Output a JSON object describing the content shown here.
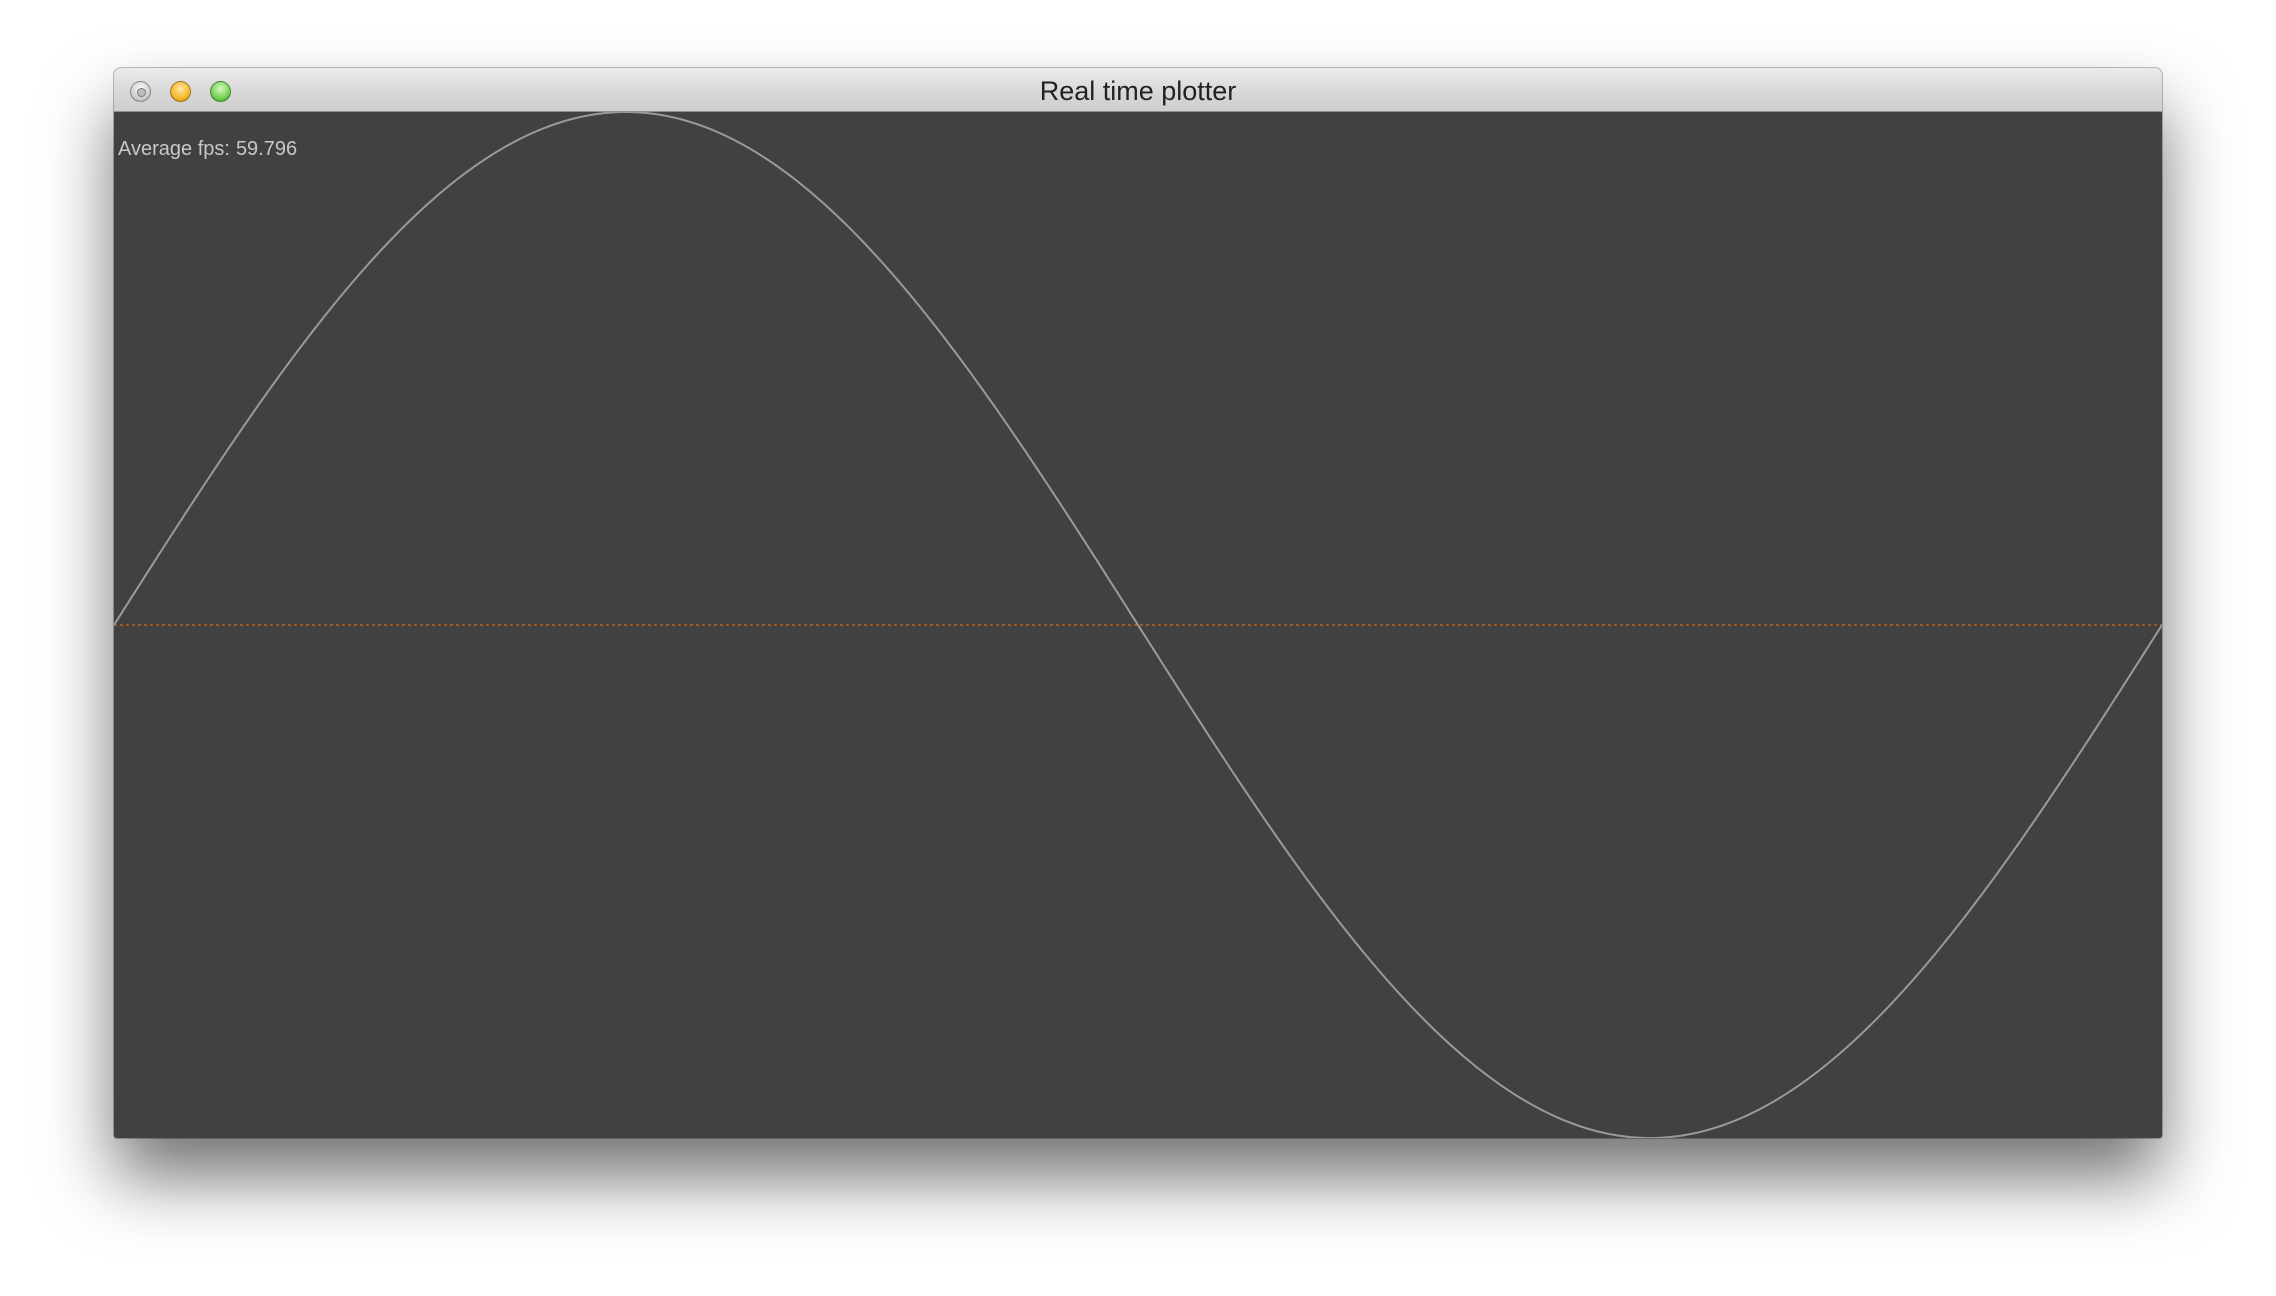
{
  "window": {
    "title": "Real time plotter",
    "controls": {
      "close": "close-icon",
      "minimize": "minimize-icon",
      "zoom": "zoom-icon"
    }
  },
  "overlay": {
    "fps_label": "Average fps:",
    "fps_value": "59.796"
  },
  "colors": {
    "background": "#414141",
    "signal": "#9a9a9a",
    "baseline": "#a0581f"
  },
  "chart_data": {
    "type": "line",
    "series": [
      {
        "function": "sine",
        "periods_visible": 1,
        "x": [
          0,
          0.125,
          0.25,
          0.375,
          0.5,
          0.625,
          0.75,
          0.875,
          1
        ],
        "y": [
          0,
          0.707,
          1,
          0.707,
          0,
          -0.707,
          -1,
          -0.707,
          0
        ]
      }
    ],
    "baseline_y": 0,
    "ylim": [
      -1,
      1
    ],
    "xlim": [
      0,
      1
    ],
    "grid": false
  }
}
